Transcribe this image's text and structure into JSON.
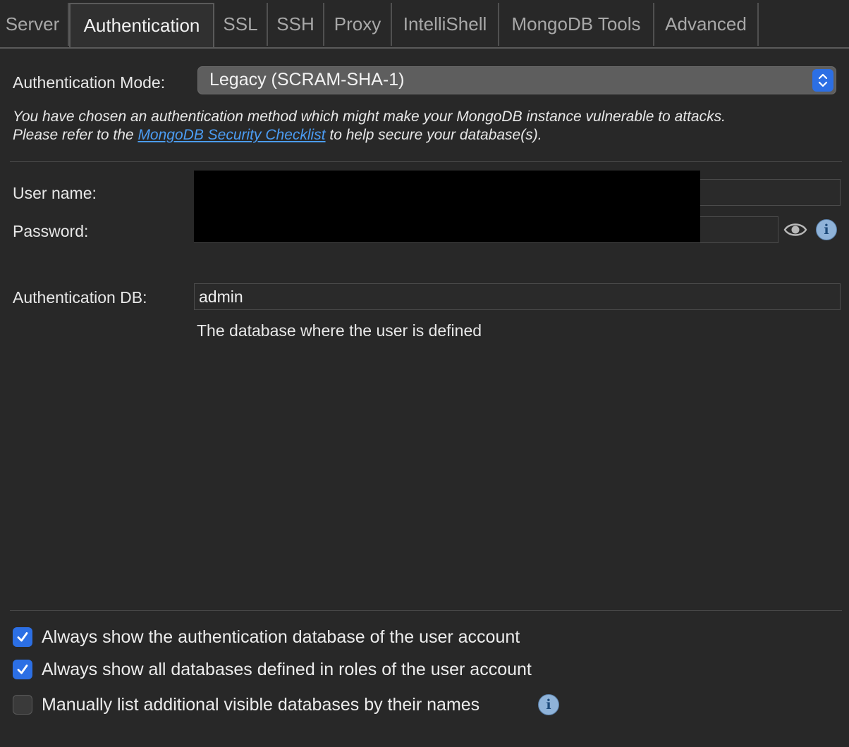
{
  "tabs": [
    {
      "label": "Server",
      "active": false
    },
    {
      "label": "Authentication",
      "active": true
    },
    {
      "label": "SSL",
      "active": false
    },
    {
      "label": "SSH",
      "active": false
    },
    {
      "label": "Proxy",
      "active": false
    },
    {
      "label": "IntelliShell",
      "active": false
    },
    {
      "label": "MongoDB Tools",
      "active": false
    },
    {
      "label": "Advanced",
      "active": false
    }
  ],
  "auth": {
    "mode_label": "Authentication Mode:",
    "mode_value": "Legacy (SCRAM-SHA-1)",
    "warning_line1": "You have chosen an authentication method which might make your MongoDB instance vulnerable to attacks.",
    "warning_pre": "Please refer to the ",
    "warning_link": "MongoDB Security Checklist",
    "warning_post": " to help secure your database(s).",
    "username_label": "User name:",
    "password_label": "Password:",
    "authdb_label": "Authentication DB:",
    "authdb_value": "admin",
    "authdb_help": "The database where the user is defined"
  },
  "options": [
    {
      "label": "Always show the authentication database of the user account",
      "checked": true
    },
    {
      "label": "Always show all databases defined in roles of the user account",
      "checked": true
    },
    {
      "label": "Manually list additional visible databases by their names",
      "checked": false
    }
  ],
  "icons": {
    "info": "info-icon",
    "eye": "eye-icon",
    "stepper": "chevron-up-down-icon",
    "check": "checkmark-icon"
  },
  "colors": {
    "accent": "#2c6fe4",
    "link": "#4b9cf3",
    "background": "#282828"
  }
}
